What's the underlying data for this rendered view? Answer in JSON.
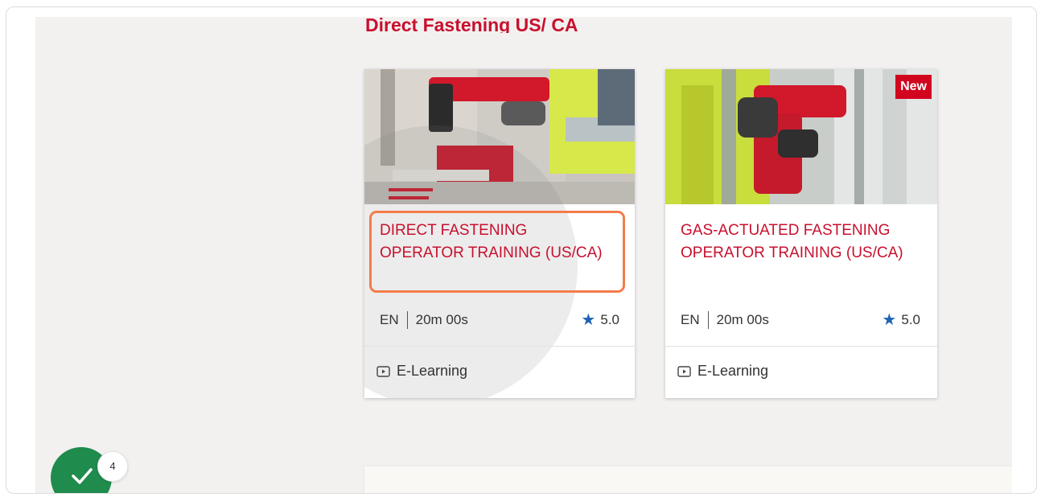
{
  "section": {
    "title": "Direct Fastening US/ CA"
  },
  "courses": [
    {
      "title": "DIRECT FASTENING OPERATOR TRAINING (US/CA)",
      "language": "EN",
      "duration": "20m 00s",
      "rating": "5.0",
      "type": "E-Learning",
      "badge": ""
    },
    {
      "title": "GAS-ACTUATED FASTENING OPERATOR TRAINING (US/CA)",
      "language": "EN",
      "duration": "20m 00s",
      "rating": "5.0",
      "type": "E-Learning",
      "badge": "New"
    }
  ],
  "progress": {
    "count": "4"
  },
  "icons": {
    "rating": "star-icon",
    "course_type": "play-video-icon",
    "progress": "checkmark-icon"
  },
  "colors": {
    "brand_red": "#c8102e",
    "highlight": "#f47c4a",
    "star": "#1f63b4",
    "success": "#1f8b4d"
  }
}
